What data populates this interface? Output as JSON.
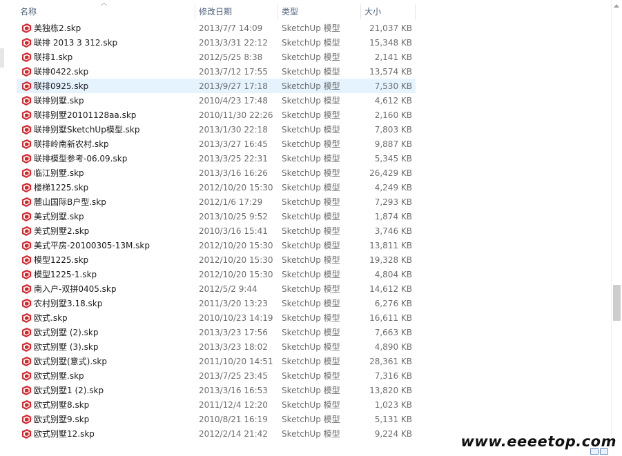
{
  "columns": {
    "name": "名称",
    "date": "修改日期",
    "type": "类型",
    "size": "大小"
  },
  "icons": {
    "file": "sketchup-file-icon",
    "sort": "sort-ascending-icon"
  },
  "colors": {
    "selected_row": "#e5f3ff",
    "icon_red": "#d8262c",
    "header_text": "#4c607a"
  },
  "files": [
    {
      "name": "美独栋2.skp",
      "date": "2013/7/7 14:09",
      "type": "SketchUp 模型",
      "size": "21,037 KB"
    },
    {
      "name": "联排 2013 3 312.skp",
      "date": "2013/3/31 22:12",
      "type": "SketchUp 模型",
      "size": "15,348 KB"
    },
    {
      "name": "联排1.skp",
      "date": "2012/5/25 8:38",
      "type": "SketchUp 模型",
      "size": "2,141 KB"
    },
    {
      "name": "联排0422.skp",
      "date": "2013/7/12 17:55",
      "type": "SketchUp 模型",
      "size": "13,574 KB"
    },
    {
      "name": "联排0925.skp",
      "date": "2013/9/27 17:18",
      "type": "SketchUp 模型",
      "size": "7,530 KB",
      "selected": true
    },
    {
      "name": "联排别墅.skp",
      "date": "2010/4/23 17:48",
      "type": "SketchUp 模型",
      "size": "4,612 KB"
    },
    {
      "name": "联排别墅20101128aa.skp",
      "date": "2010/11/30 22:26",
      "type": "SketchUp 模型",
      "size": "2,160 KB"
    },
    {
      "name": "联排别墅SketchUp模型.skp",
      "date": "2013/1/30 22:18",
      "type": "SketchUp 模型",
      "size": "7,803 KB"
    },
    {
      "name": "联排岭南新农村.skp",
      "date": "2013/3/27 16:45",
      "type": "SketchUp 模型",
      "size": "9,887 KB"
    },
    {
      "name": "联排模型参考-06.09.skp",
      "date": "2013/3/25 22:31",
      "type": "SketchUp 模型",
      "size": "5,345 KB"
    },
    {
      "name": "临江别墅.skp",
      "date": "2013/3/16 16:26",
      "type": "SketchUp 模型",
      "size": "26,429 KB"
    },
    {
      "name": "楼梯1225.skp",
      "date": "2012/10/20 15:30",
      "type": "SketchUp 模型",
      "size": "4,249 KB"
    },
    {
      "name": "麓山国际B户型.skp",
      "date": "2012/1/6 17:29",
      "type": "SketchUp 模型",
      "size": "7,293 KB"
    },
    {
      "name": "美式别墅.skp",
      "date": "2013/10/25 9:52",
      "type": "SketchUp 模型",
      "size": "1,874 KB"
    },
    {
      "name": "美式别墅2.skp",
      "date": "2010/3/16 15:41",
      "type": "SketchUp 模型",
      "size": "3,746 KB"
    },
    {
      "name": "美式平房-20100305-13M.skp",
      "date": "2012/10/20 15:30",
      "type": "SketchUp 模型",
      "size": "13,811 KB"
    },
    {
      "name": "模型1225.skp",
      "date": "2012/10/20 15:30",
      "type": "SketchUp 模型",
      "size": "19,328 KB"
    },
    {
      "name": "模型1225-1.skp",
      "date": "2012/10/20 15:30",
      "type": "SketchUp 模型",
      "size": "4,804 KB"
    },
    {
      "name": "南入户-双拼0405.skp",
      "date": "2012/5/2 9:44",
      "type": "SketchUp 模型",
      "size": "14,612 KB"
    },
    {
      "name": "农村别墅3.18.skp",
      "date": "2011/3/20 13:23",
      "type": "SketchUp 模型",
      "size": "6,276 KB"
    },
    {
      "name": "欧式.skp",
      "date": "2010/10/23 14:19",
      "type": "SketchUp 模型",
      "size": "16,611 KB"
    },
    {
      "name": "欧式别墅 (2).skp",
      "date": "2013/3/23 17:56",
      "type": "SketchUp 模型",
      "size": "7,663 KB"
    },
    {
      "name": "欧式别墅 (3).skp",
      "date": "2013/3/23 18:02",
      "type": "SketchUp 模型",
      "size": "4,890 KB"
    },
    {
      "name": "欧式别墅(意式).skp",
      "date": "2011/10/20 14:51",
      "type": "SketchUp 模型",
      "size": "28,361 KB"
    },
    {
      "name": "欧式别墅.skp",
      "date": "2013/7/25 23:45",
      "type": "SketchUp 模型",
      "size": "7,316 KB"
    },
    {
      "name": "欧式别墅1 (2).skp",
      "date": "2013/3/16 16:53",
      "type": "SketchUp 模型",
      "size": "13,820 KB"
    },
    {
      "name": "欧式别墅8.skp",
      "date": "2011/12/4 12:20",
      "type": "SketchUp 模型",
      "size": "1,023 KB"
    },
    {
      "name": "欧式别墅9.skp",
      "date": "2010/8/21 16:19",
      "type": "SketchUp 模型",
      "size": "5,131 KB"
    },
    {
      "name": "欧式别墅12.skp",
      "date": "2012/2/14 21:42",
      "type": "SketchUp 模型",
      "size": "9,224 KB"
    }
  ],
  "watermark": "www.eeeetop.com"
}
